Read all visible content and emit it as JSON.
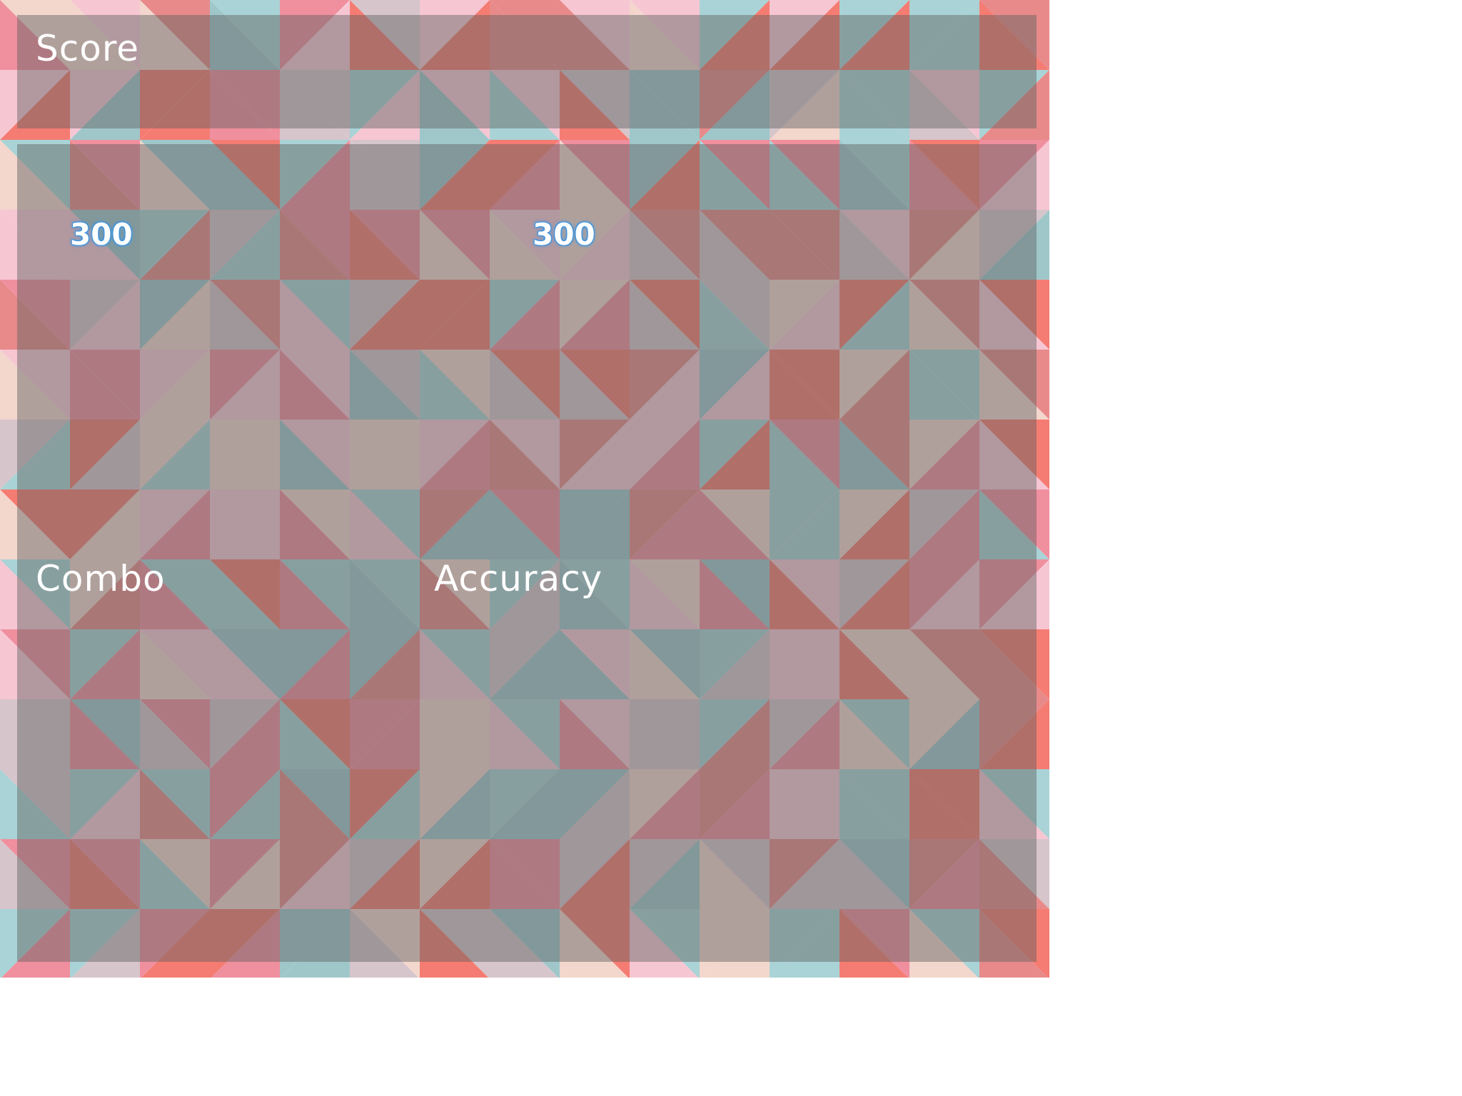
{
  "hud": {
    "score_label": "Score",
    "combo_label": "Combo",
    "accuracy_label": "Accuracy"
  },
  "hit_judgements": [
    {
      "value": "300"
    },
    {
      "value": "300"
    }
  ],
  "colors": {
    "panel_overlay": "#5f5f5f",
    "text": "#ffffff",
    "hit_glow": "#3a8fd8",
    "pattern_palette": [
      "#f08f9e",
      "#f57c72",
      "#a9d3d6",
      "#f6c6d3",
      "#f3d6cc",
      "#d6c5cb",
      "#9fc7ca",
      "#e88a8a"
    ]
  },
  "background": {
    "style": "triangle-mosaic"
  }
}
